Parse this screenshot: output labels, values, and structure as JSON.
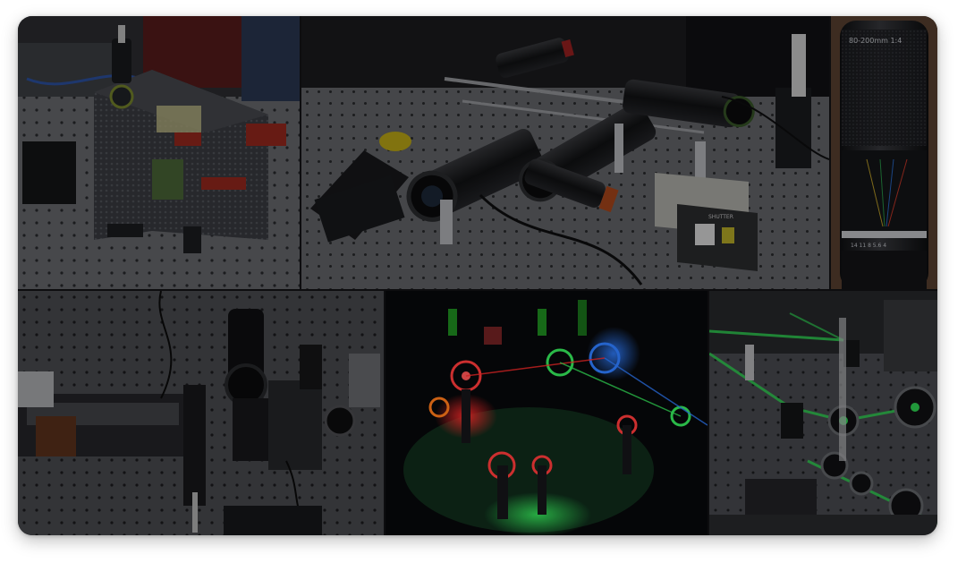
{
  "collage": {
    "lens_engraving": "80-200mm 1:4",
    "lens_scale": "14 11 8 5.6 4",
    "equipment_tag": "SHUTTER",
    "colors": {
      "laser_green": "#34e85a",
      "laser_red": "#ff2a2a",
      "laser_blue": "#2f7dff",
      "table_gray": "#8b8d92",
      "dark_overlay": "#000000"
    }
  }
}
